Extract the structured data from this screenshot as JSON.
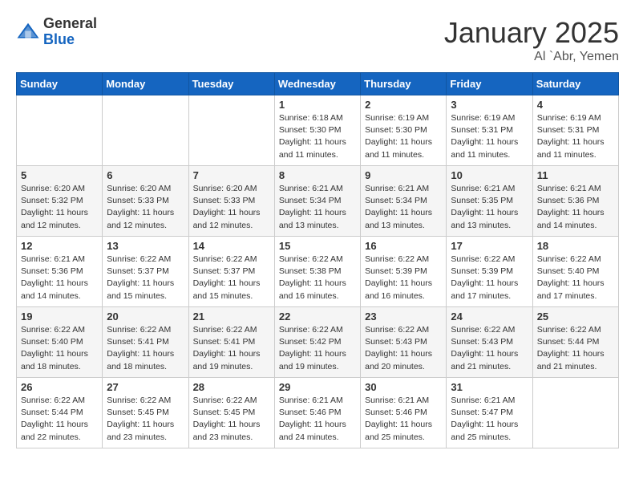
{
  "logo": {
    "general": "General",
    "blue": "Blue"
  },
  "header": {
    "month": "January 2025",
    "location": "Al `Abr, Yemen"
  },
  "days_header": [
    "Sunday",
    "Monday",
    "Tuesday",
    "Wednesday",
    "Thursday",
    "Friday",
    "Saturday"
  ],
  "weeks": [
    [
      {
        "day": "",
        "info": ""
      },
      {
        "day": "",
        "info": ""
      },
      {
        "day": "",
        "info": ""
      },
      {
        "day": "1",
        "info": "Sunrise: 6:18 AM\nSunset: 5:30 PM\nDaylight: 11 hours\nand 11 minutes."
      },
      {
        "day": "2",
        "info": "Sunrise: 6:19 AM\nSunset: 5:30 PM\nDaylight: 11 hours\nand 11 minutes."
      },
      {
        "day": "3",
        "info": "Sunrise: 6:19 AM\nSunset: 5:31 PM\nDaylight: 11 hours\nand 11 minutes."
      },
      {
        "day": "4",
        "info": "Sunrise: 6:19 AM\nSunset: 5:31 PM\nDaylight: 11 hours\nand 11 minutes."
      }
    ],
    [
      {
        "day": "5",
        "info": "Sunrise: 6:20 AM\nSunset: 5:32 PM\nDaylight: 11 hours\nand 12 minutes."
      },
      {
        "day": "6",
        "info": "Sunrise: 6:20 AM\nSunset: 5:33 PM\nDaylight: 11 hours\nand 12 minutes."
      },
      {
        "day": "7",
        "info": "Sunrise: 6:20 AM\nSunset: 5:33 PM\nDaylight: 11 hours\nand 12 minutes."
      },
      {
        "day": "8",
        "info": "Sunrise: 6:21 AM\nSunset: 5:34 PM\nDaylight: 11 hours\nand 13 minutes."
      },
      {
        "day": "9",
        "info": "Sunrise: 6:21 AM\nSunset: 5:34 PM\nDaylight: 11 hours\nand 13 minutes."
      },
      {
        "day": "10",
        "info": "Sunrise: 6:21 AM\nSunset: 5:35 PM\nDaylight: 11 hours\nand 13 minutes."
      },
      {
        "day": "11",
        "info": "Sunrise: 6:21 AM\nSunset: 5:36 PM\nDaylight: 11 hours\nand 14 minutes."
      }
    ],
    [
      {
        "day": "12",
        "info": "Sunrise: 6:21 AM\nSunset: 5:36 PM\nDaylight: 11 hours\nand 14 minutes."
      },
      {
        "day": "13",
        "info": "Sunrise: 6:22 AM\nSunset: 5:37 PM\nDaylight: 11 hours\nand 15 minutes."
      },
      {
        "day": "14",
        "info": "Sunrise: 6:22 AM\nSunset: 5:37 PM\nDaylight: 11 hours\nand 15 minutes."
      },
      {
        "day": "15",
        "info": "Sunrise: 6:22 AM\nSunset: 5:38 PM\nDaylight: 11 hours\nand 16 minutes."
      },
      {
        "day": "16",
        "info": "Sunrise: 6:22 AM\nSunset: 5:39 PM\nDaylight: 11 hours\nand 16 minutes."
      },
      {
        "day": "17",
        "info": "Sunrise: 6:22 AM\nSunset: 5:39 PM\nDaylight: 11 hours\nand 17 minutes."
      },
      {
        "day": "18",
        "info": "Sunrise: 6:22 AM\nSunset: 5:40 PM\nDaylight: 11 hours\nand 17 minutes."
      }
    ],
    [
      {
        "day": "19",
        "info": "Sunrise: 6:22 AM\nSunset: 5:40 PM\nDaylight: 11 hours\nand 18 minutes."
      },
      {
        "day": "20",
        "info": "Sunrise: 6:22 AM\nSunset: 5:41 PM\nDaylight: 11 hours\nand 18 minutes."
      },
      {
        "day": "21",
        "info": "Sunrise: 6:22 AM\nSunset: 5:41 PM\nDaylight: 11 hours\nand 19 minutes."
      },
      {
        "day": "22",
        "info": "Sunrise: 6:22 AM\nSunset: 5:42 PM\nDaylight: 11 hours\nand 19 minutes."
      },
      {
        "day": "23",
        "info": "Sunrise: 6:22 AM\nSunset: 5:43 PM\nDaylight: 11 hours\nand 20 minutes."
      },
      {
        "day": "24",
        "info": "Sunrise: 6:22 AM\nSunset: 5:43 PM\nDaylight: 11 hours\nand 21 minutes."
      },
      {
        "day": "25",
        "info": "Sunrise: 6:22 AM\nSunset: 5:44 PM\nDaylight: 11 hours\nand 21 minutes."
      }
    ],
    [
      {
        "day": "26",
        "info": "Sunrise: 6:22 AM\nSunset: 5:44 PM\nDaylight: 11 hours\nand 22 minutes."
      },
      {
        "day": "27",
        "info": "Sunrise: 6:22 AM\nSunset: 5:45 PM\nDaylight: 11 hours\nand 23 minutes."
      },
      {
        "day": "28",
        "info": "Sunrise: 6:22 AM\nSunset: 5:45 PM\nDaylight: 11 hours\nand 23 minutes."
      },
      {
        "day": "29",
        "info": "Sunrise: 6:21 AM\nSunset: 5:46 PM\nDaylight: 11 hours\nand 24 minutes."
      },
      {
        "day": "30",
        "info": "Sunrise: 6:21 AM\nSunset: 5:46 PM\nDaylight: 11 hours\nand 25 minutes."
      },
      {
        "day": "31",
        "info": "Sunrise: 6:21 AM\nSunset: 5:47 PM\nDaylight: 11 hours\nand 25 minutes."
      },
      {
        "day": "",
        "info": ""
      }
    ]
  ]
}
